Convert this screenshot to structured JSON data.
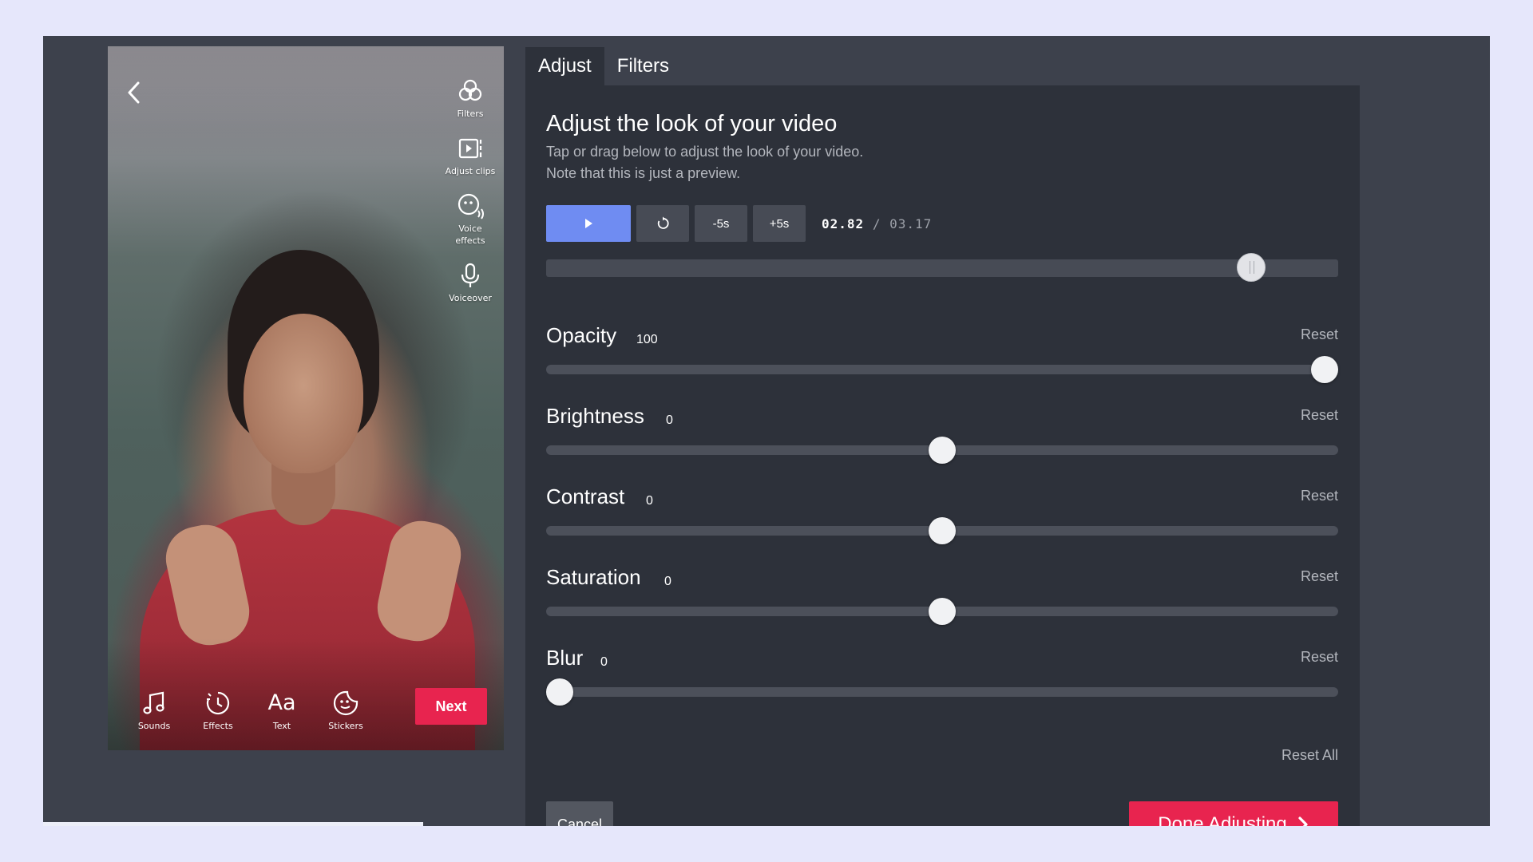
{
  "phone": {
    "back_icon": "chevron-left-icon",
    "rail": [
      {
        "label": "Filters",
        "icon": "filters-icon"
      },
      {
        "label": "Adjust clips",
        "icon": "adjust-clips-icon"
      },
      {
        "label": "Voice effects",
        "icon": "voice-effects-icon"
      },
      {
        "label": "Voiceover",
        "icon": "microphone-icon"
      }
    ],
    "tools": [
      {
        "label": "Sounds",
        "icon": "music-note-icon"
      },
      {
        "label": "Effects",
        "icon": "effects-icon"
      },
      {
        "label": "Text",
        "glyph": "Aa",
        "icon": "text-icon"
      },
      {
        "label": "Stickers",
        "icon": "sticker-icon"
      }
    ],
    "next_label": "Next"
  },
  "tabs": {
    "adjust": "Adjust",
    "filters": "Filters"
  },
  "panel": {
    "title": "Adjust the look of your video",
    "desc_line1": "Tap or drag below to adjust the look of your video.",
    "desc_line2": "Note that this is just a preview."
  },
  "playback": {
    "play_icon": "play-icon",
    "restart_icon": "restart-icon",
    "minus_label": "-5s",
    "plus_label": "+5s",
    "current": "02.82",
    "separator": "/",
    "total": "03.17",
    "progress": 0.89
  },
  "adjustments": [
    {
      "name": "Opacity",
      "value": "100",
      "level": 1.0,
      "reset": "Reset"
    },
    {
      "name": "Brightness",
      "value": "0",
      "level": 0.5,
      "reset": "Reset"
    },
    {
      "name": "Contrast",
      "value": "0",
      "level": 0.5,
      "reset": "Reset"
    },
    {
      "name": "Saturation",
      "value": "0",
      "level": 0.5,
      "reset": "Reset"
    },
    {
      "name": "Blur",
      "value": "0",
      "level": 0.0,
      "reset": "Reset"
    }
  ],
  "reset_all": "Reset All",
  "cancel_label": "Cancel",
  "done_label": "Done Adjusting",
  "colors": {
    "accent_red": "#e8244f",
    "accent_blue": "#6f8cf2",
    "panel_bg": "#2d313a",
    "app_bg": "#3d414c",
    "page_bg": "#e6e7fb"
  }
}
